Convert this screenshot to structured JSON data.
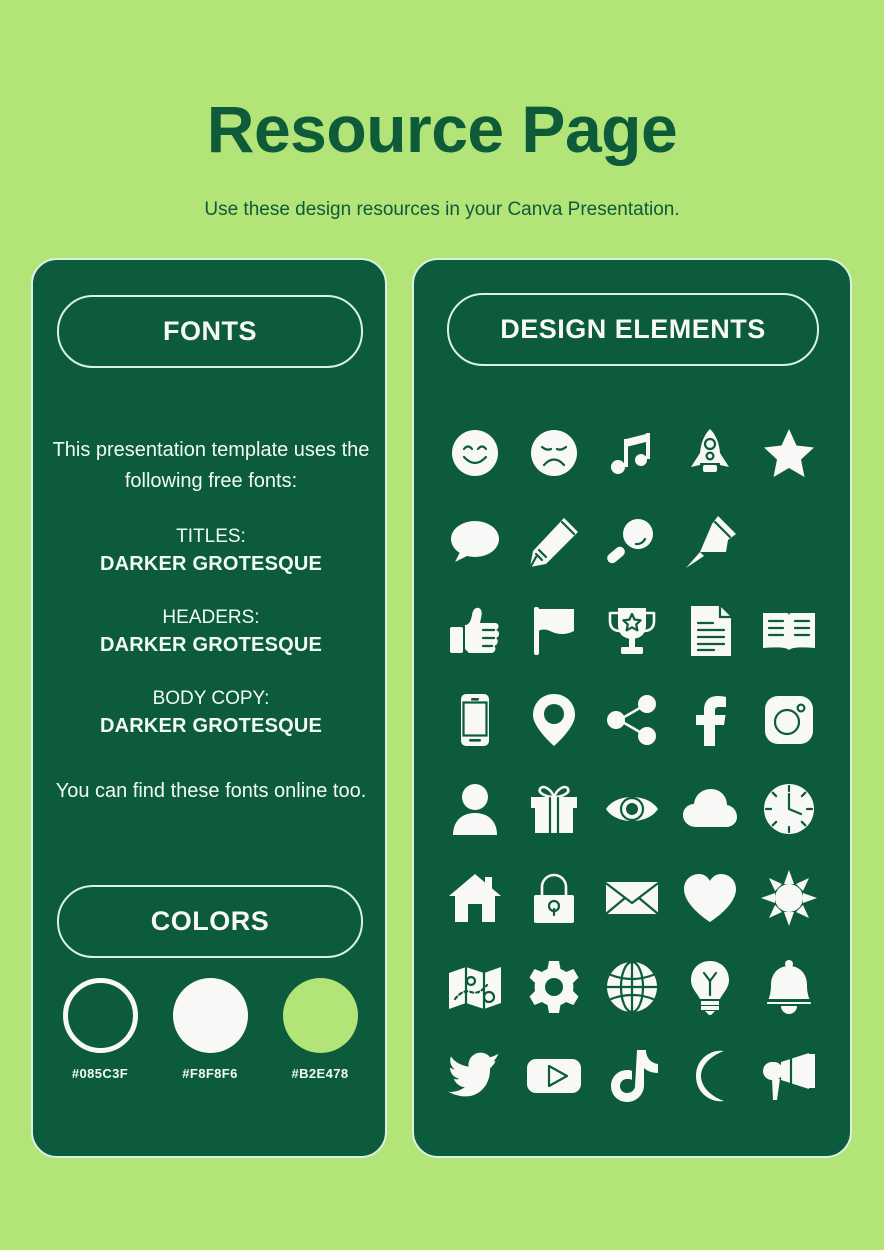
{
  "header": {
    "title": "Resource Page",
    "subtitle": "Use these design resources in your Canva Presentation."
  },
  "colors": {
    "background": "#B2E478",
    "panel": "#085C3F",
    "text_light": "#F8F8F6",
    "title": "#085C3F"
  },
  "fonts_panel": {
    "pill_label": "FONTS",
    "intro": "This presentation template uses the following free fonts:",
    "groups": [
      {
        "role": "TITLES:",
        "font": "DARKER GROTESQUE"
      },
      {
        "role": "HEADERS:",
        "font": "DARKER GROTESQUE"
      },
      {
        "role": "BODY COPY:",
        "font": "DARKER GROTESQUE"
      }
    ],
    "outro": "You can find these fonts online too.",
    "colors_pill_label": "COLORS",
    "swatches": [
      {
        "hex": "#085C3F",
        "style": "outline"
      },
      {
        "hex": "#F8F8F6",
        "style": "solid"
      },
      {
        "hex": "#B2E478",
        "style": "solid"
      }
    ]
  },
  "elements_panel": {
    "pill_label": "DESIGN ELEMENTS",
    "icons": [
      "smiley-face-icon",
      "sad-face-icon",
      "music-note-icon",
      "rocket-icon",
      "star-icon",
      "speech-bubble-icon",
      "pencil-icon",
      "magnifying-glass-icon",
      "pushpin-icon",
      "thumbs-up-icon",
      "flag-icon",
      "trophy-icon",
      "document-icon",
      "open-book-icon",
      "smartphone-icon",
      "location-pin-icon",
      "share-icon",
      "facebook-icon",
      "instagram-icon",
      "person-icon",
      "gift-icon",
      "eye-icon",
      "cloud-icon",
      "clock-icon",
      "home-icon",
      "padlock-icon",
      "envelope-icon",
      "heart-icon",
      "sun-icon",
      "map-icon",
      "gear-icon",
      "globe-icon",
      "lightbulb-icon",
      "bell-icon",
      "twitter-icon",
      "youtube-icon",
      "tiktok-icon",
      "moon-icon",
      "megaphone-icon"
    ]
  }
}
